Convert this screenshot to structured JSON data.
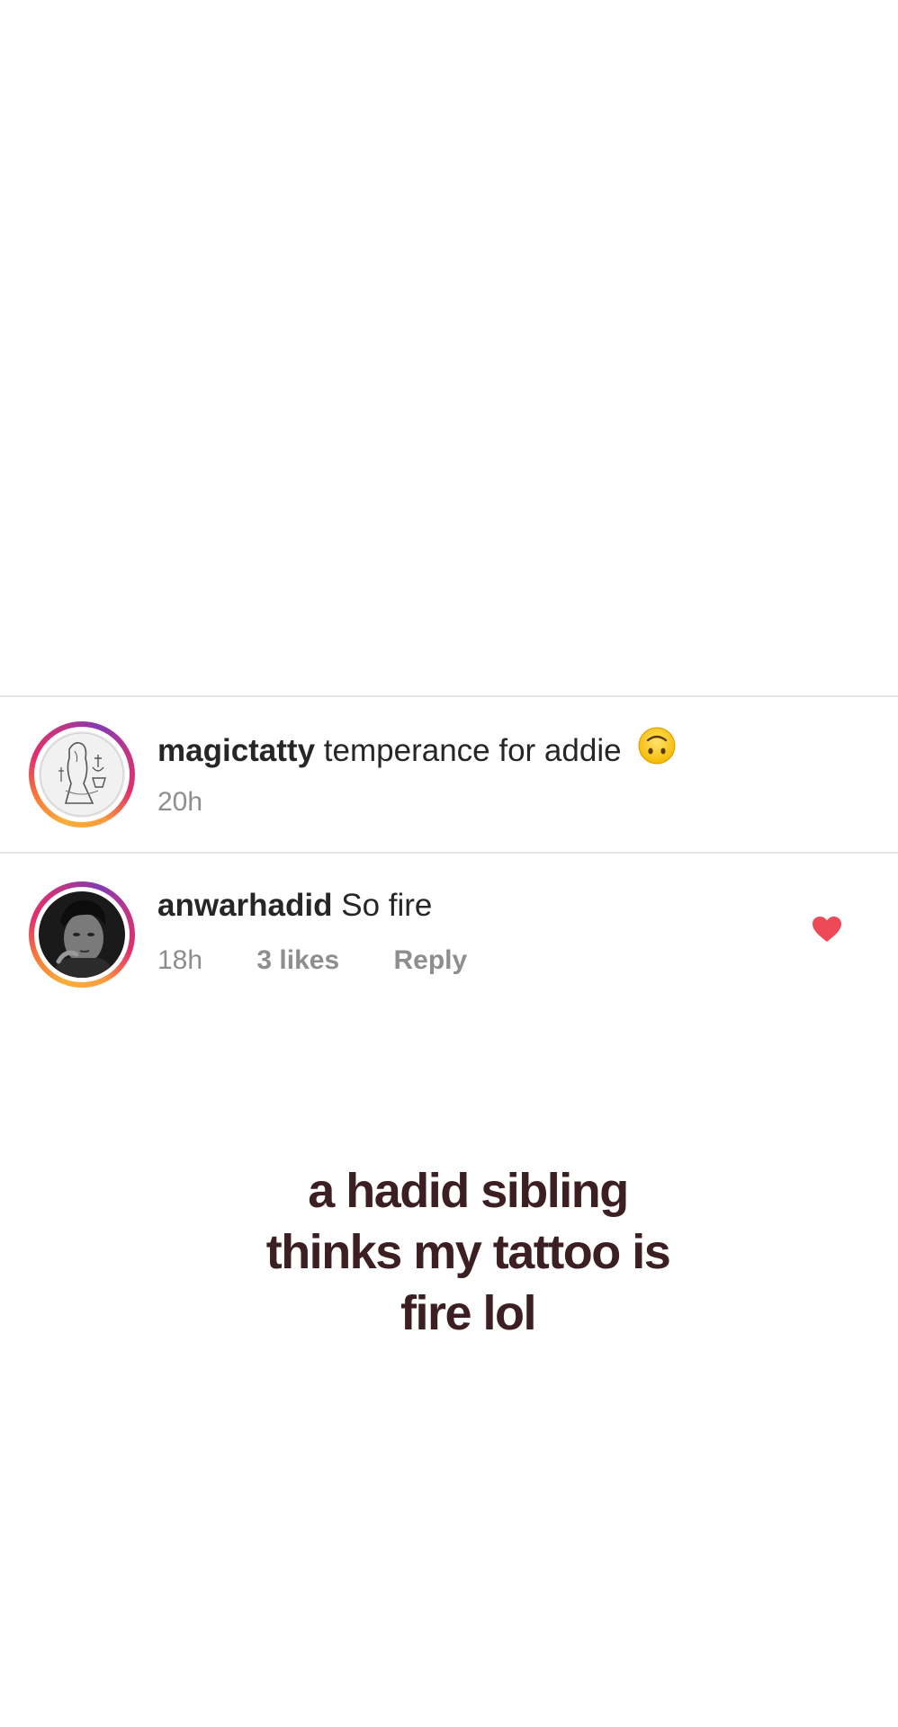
{
  "comments": [
    {
      "username": "magictatty",
      "text": "temperance for addie",
      "emoji": "upside-down-face-emoji",
      "time": "20h"
    },
    {
      "username": "anwarhadid",
      "text": "So fire",
      "time": "18h",
      "likes": "3 likes",
      "reply_label": "Reply",
      "liked": true,
      "heart_color": "#ed4956"
    }
  ],
  "caption": {
    "lines": [
      "a hadid sibling",
      "thinks my tattoo is",
      "fire lol"
    ],
    "color": "#3c1f22"
  },
  "colors": {
    "text_primary": "#262626",
    "text_secondary": "#8e8e8e",
    "divider": "#e6e6e6"
  }
}
